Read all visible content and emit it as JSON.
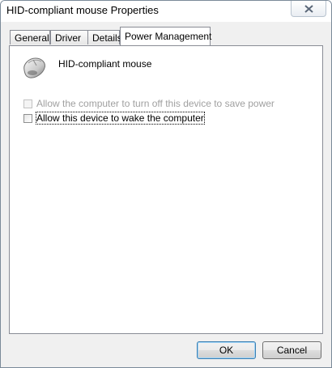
{
  "window": {
    "title": "HID-compliant mouse Properties"
  },
  "tabs": [
    {
      "label": "General",
      "active": false
    },
    {
      "label": "Driver",
      "active": false
    },
    {
      "label": "Details",
      "active": false
    },
    {
      "label": "Power Management",
      "active": true
    }
  ],
  "device": {
    "name": "HID-compliant mouse",
    "icon": "mouse-icon"
  },
  "options": [
    {
      "label": "Allow the computer to turn off this device to save power",
      "checked": false,
      "enabled": false
    },
    {
      "label": "Allow this device to wake the computer",
      "checked": false,
      "enabled": true
    }
  ],
  "buttons": {
    "ok": "OK",
    "cancel": "Cancel"
  },
  "colors": {
    "accent_border": "#3c7fb1",
    "close_x": "#5a6778"
  }
}
